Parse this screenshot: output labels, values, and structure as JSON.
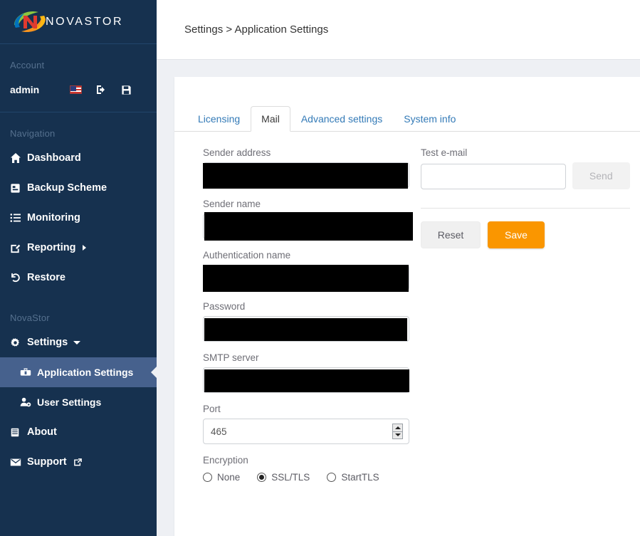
{
  "brand": {
    "logo_text": "NOVASTOR",
    "accent_red": "#e03a2f",
    "accent_orange": "#f7941e",
    "accent_green": "#8cc63e",
    "accent_blue": "#0072bc"
  },
  "sidebar": {
    "account_section": "Account",
    "user": "admin",
    "account_icons": [
      {
        "name": "language-flag-icon",
        "label": "English (US)"
      },
      {
        "name": "logout-icon",
        "label": "Logout"
      },
      {
        "name": "save-icon",
        "label": "Save"
      }
    ],
    "navigation_section": "Navigation",
    "nav_items": [
      {
        "label": "Dashboard",
        "icon": "home-icon",
        "has_caret": false
      },
      {
        "label": "Backup Scheme",
        "icon": "clipboard-icon",
        "has_caret": false
      },
      {
        "label": "Monitoring",
        "icon": "list-icon",
        "has_caret": false
      },
      {
        "label": "Reporting",
        "icon": "edit-icon",
        "has_caret": true
      },
      {
        "label": "Restore",
        "icon": "undo-icon",
        "has_caret": false
      }
    ],
    "product_section": "NovaStor",
    "product_items": [
      {
        "label": "Settings",
        "icon": "gear-icon",
        "expanded": true,
        "active": false,
        "sub": false
      },
      {
        "label": "Application Settings",
        "icon": "toolbox-icon",
        "active": true,
        "sub": true
      },
      {
        "label": "User Settings",
        "icon": "user-gear-icon",
        "active": false,
        "sub": true
      },
      {
        "label": "About",
        "icon": "book-icon",
        "active": false,
        "sub": false
      },
      {
        "label": "Support",
        "icon": "envelope-icon",
        "external": true,
        "active": false,
        "sub": false
      }
    ],
    "support_external_icon": "external-link-icon"
  },
  "header": {
    "breadcrumb": "Settings > Application Settings"
  },
  "tabs": [
    {
      "label": "Licensing",
      "active": false
    },
    {
      "label": "Mail",
      "active": true
    },
    {
      "label": "Advanced settings",
      "active": false
    },
    {
      "label": "System info",
      "active": false
    }
  ],
  "form": {
    "fields": [
      {
        "label": "Sender address",
        "value": "",
        "redacted": true
      },
      {
        "label": "Sender name",
        "value": "",
        "redacted": true
      },
      {
        "label": "Authentication name",
        "value": "",
        "redacted": true
      },
      {
        "label": "Password",
        "value": "",
        "redacted": true
      },
      {
        "label": "SMTP server",
        "value": "",
        "redacted": true
      }
    ],
    "port": {
      "label": "Port",
      "value": "465"
    },
    "encryption": {
      "label": "Encryption",
      "options": [
        {
          "label": "None",
          "selected": false
        },
        {
          "label": "SSL/TLS",
          "selected": true
        },
        {
          "label": "StartTLS",
          "selected": false
        }
      ]
    }
  },
  "side_panel": {
    "test_email_label": "Test e-mail",
    "test_email_value": "",
    "test_email_placeholder": "",
    "send_label": "Send",
    "send_disabled": true,
    "reset_label": "Reset",
    "save_label": "Save",
    "save_color": "#fa9600"
  }
}
